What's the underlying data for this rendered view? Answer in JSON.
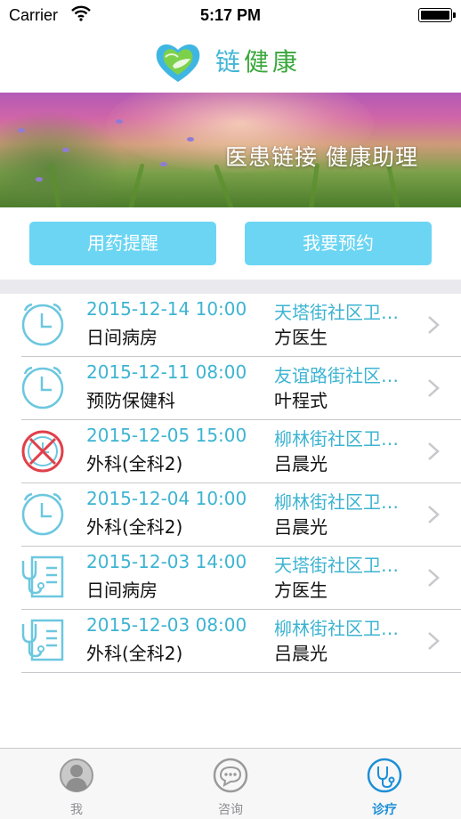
{
  "status_bar": {
    "carrier": "Carrier",
    "time": "5:17 PM",
    "wifi_icon": "wifi-icon",
    "battery_icon": "battery-icon"
  },
  "header": {
    "logo_icon": "heart-logo-icon",
    "app_name_part1": "链",
    "app_name_part2": "健康",
    "colors": {
      "blue": "#41b6d6",
      "green": "#3aa83d"
    }
  },
  "banner": {
    "tagline": "医患链接  健康助理"
  },
  "actions": {
    "medication_reminder": "用药提醒",
    "make_appointment": "我要预约",
    "button_color": "#6bd5f3"
  },
  "appointments": [
    {
      "datetime": "2015-12-14 10:00",
      "department": "日间病房",
      "location": "天塔街社区卫…",
      "doctor": "方医生",
      "icon": "clock-icon",
      "status": "pending"
    },
    {
      "datetime": "2015-12-11 08:00",
      "department": "预防保健科",
      "location": "友谊路街社区…",
      "doctor": "叶程式",
      "icon": "clock-icon",
      "status": "pending"
    },
    {
      "datetime": "2015-12-05 15:00",
      "department": "外科(全科2)",
      "location": "柳林街社区卫…",
      "doctor": "吕晨光",
      "icon": "cancelled-clock-icon",
      "status": "cancelled"
    },
    {
      "datetime": "2015-12-04 10:00",
      "department": "外科(全科2)",
      "location": "柳林街社区卫…",
      "doctor": "吕晨光",
      "icon": "clock-icon",
      "status": "pending"
    },
    {
      "datetime": "2015-12-03 14:00",
      "department": "日间病房",
      "location": "天塔街社区卫…",
      "doctor": "方医生",
      "icon": "stethoscope-record-icon",
      "status": "treated"
    },
    {
      "datetime": "2015-12-03 08:00",
      "department": "外科(全科2)",
      "location": "柳林街社区卫…",
      "doctor": "吕晨光",
      "icon": "stethoscope-record-icon",
      "status": "treated"
    }
  ],
  "tabs": [
    {
      "label": "我",
      "icon": "person-icon",
      "active": false
    },
    {
      "label": "咨询",
      "icon": "chat-bubble-icon",
      "active": false
    },
    {
      "label": "诊疗",
      "icon": "stethoscope-icon",
      "active": true
    }
  ],
  "colors": {
    "accent": "#3db4d2",
    "active_tab": "#1c8fd7",
    "cancelled": "#e0404a"
  }
}
